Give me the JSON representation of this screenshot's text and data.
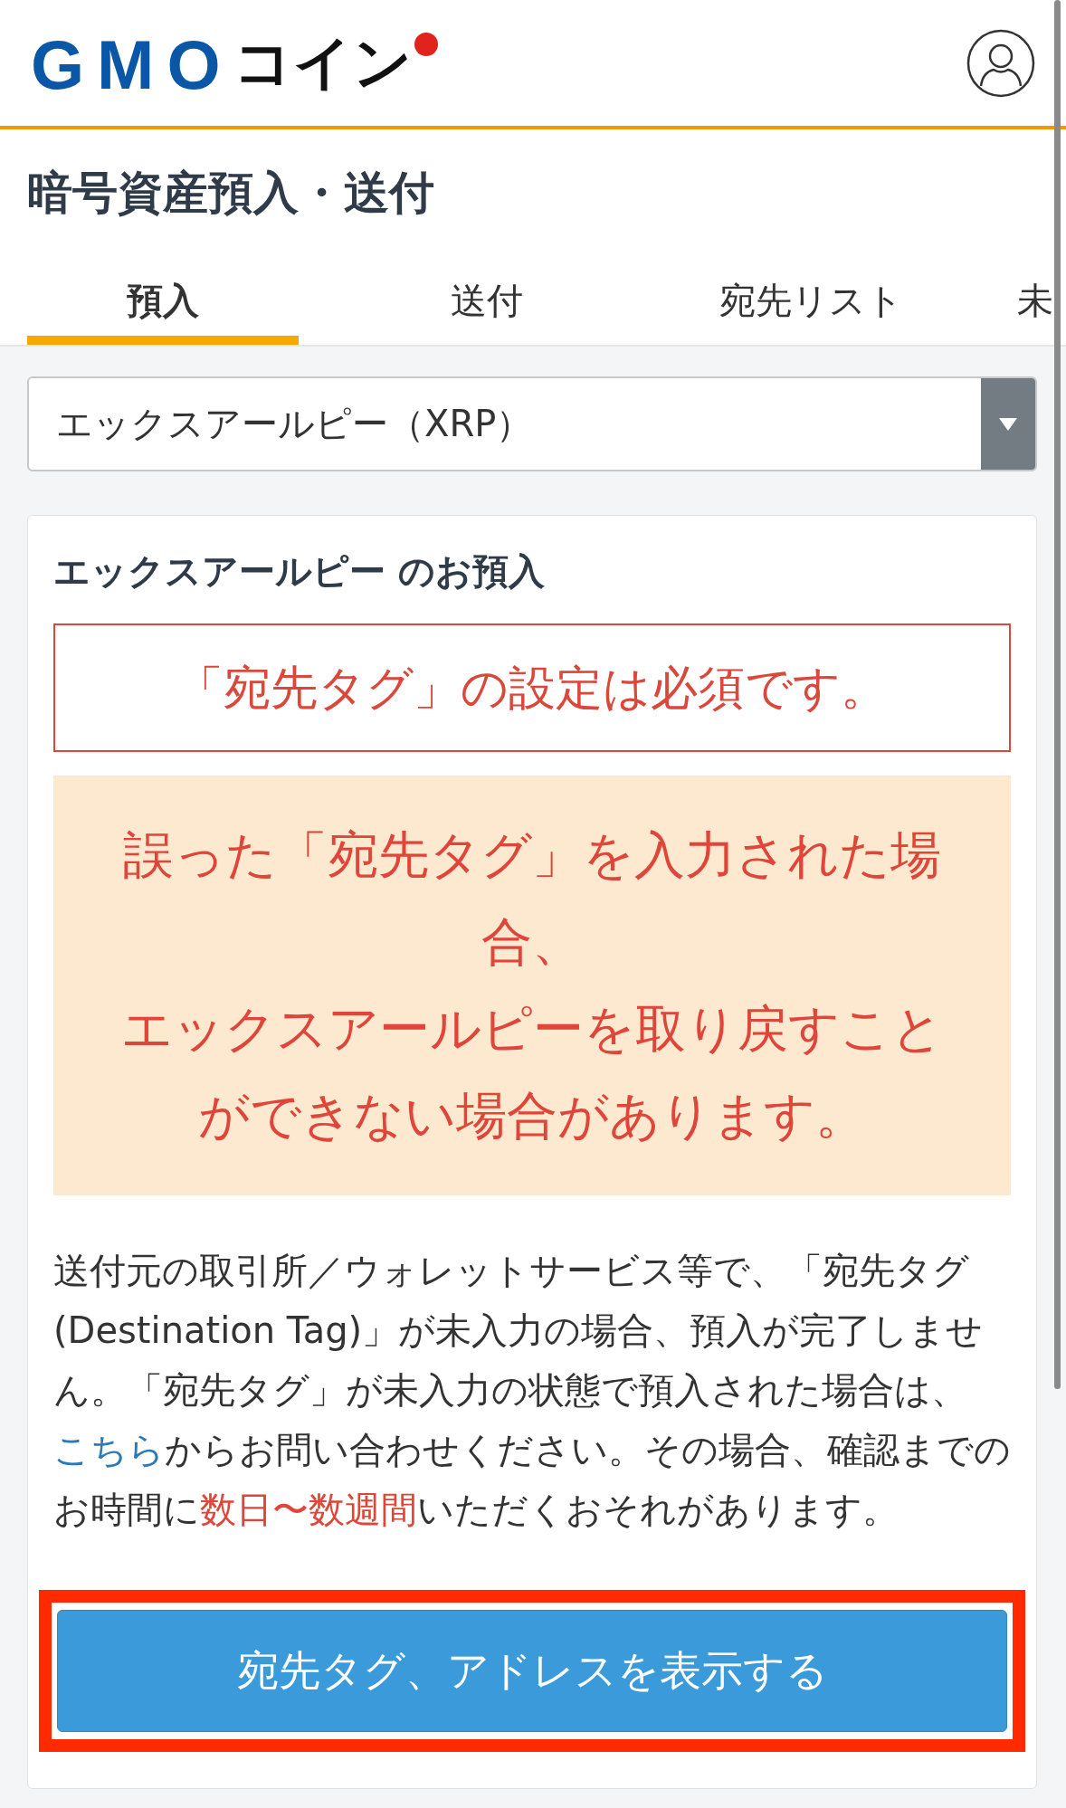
{
  "header": {
    "logo_latin": "GMO",
    "logo_kana": "コイン"
  },
  "page_title": "暗号資産預入・送付",
  "tabs": [
    {
      "label": "預入",
      "selected": true
    },
    {
      "label": "送付",
      "selected": false
    },
    {
      "label": "宛先リスト",
      "selected": false
    },
    {
      "label": "未",
      "selected": false
    }
  ],
  "currency_select": {
    "value": "エックスアールピー（XRP）"
  },
  "card": {
    "title": "エックスアールピー のお預入",
    "notice": "「宛先タグ」の設定は必須です。",
    "warning_lines": [
      "誤った「宛先タグ」を入力された場合、",
      "エックスアールピーを取り戻すことができない場合があります。"
    ],
    "description": [
      {
        "kind": "plain",
        "text": "送付元の取引所／ウォレットサービス等で、「宛先タグ(Destination Tag)」が未入力の場合、預入が完了しません。「宛先タグ」が未入力の状態で預入された場合は、"
      },
      {
        "kind": "link",
        "text": "こちら"
      },
      {
        "kind": "plain",
        "text": "からお問い合わせください。その場合、確認までのお時間に"
      },
      {
        "kind": "emphasis",
        "text": "数日〜数週間"
      },
      {
        "kind": "plain",
        "text": "いただくおそれがあります。"
      }
    ],
    "button": {
      "label": "宛先タグ、アドレスを表示する",
      "highlighted": true
    }
  }
}
